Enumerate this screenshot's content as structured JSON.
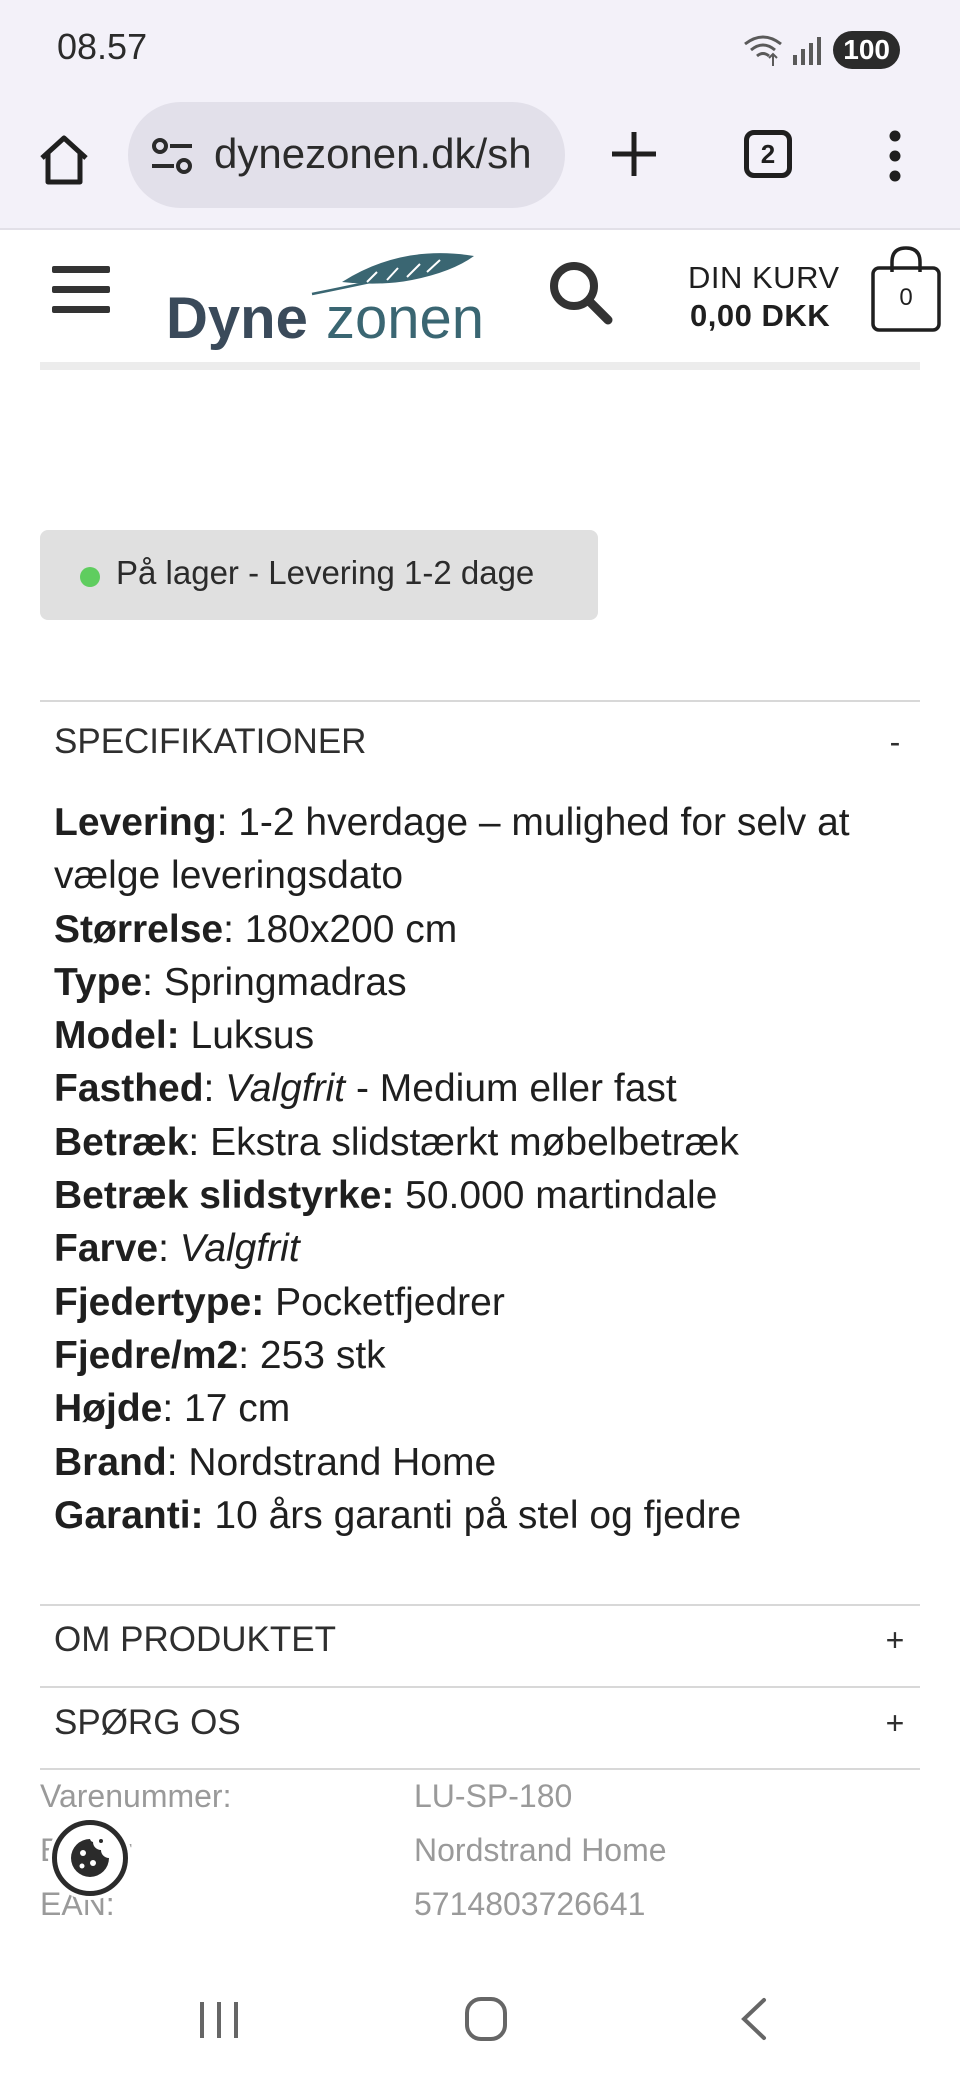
{
  "status_bar": {
    "time": "08.57",
    "battery": "100"
  },
  "browser": {
    "url": "dynezonen.dk/sh",
    "tab_count": "2"
  },
  "header": {
    "logo_text_1": "Dyne",
    "logo_text_2": "zonen",
    "cart_label": "DIN KURV",
    "cart_total": "0,00  DKK",
    "cart_count": "0",
    "colors": {
      "logo_dark": "#3a4a5a",
      "logo_teal": "#3a6672"
    }
  },
  "stock": {
    "text": "På lager - Levering 1-2 dage",
    "dot_color": "#5fcd5f"
  },
  "specs_section": {
    "title": "SPECIFIKATIONER",
    "toggle": "-",
    "rows": [
      {
        "label": "Levering",
        "sep": ": ",
        "value": "1-2 hverdage – mulighed for selv at vælge leveringsdato"
      },
      {
        "label": "Størrelse",
        "sep": ": ",
        "value": "180x200 cm"
      },
      {
        "label": "Type",
        "sep": ": ",
        "value": "Springmadras"
      },
      {
        "label": "Model:",
        "sep": " ",
        "value": "Luksus"
      },
      {
        "label": "Fasthed",
        "sep": ": ",
        "value_italic": "Valgfrit",
        "value": " - Medium eller fast"
      },
      {
        "label": "Betræk",
        "sep": ": ",
        "value": "Ekstra slidstærkt møbelbetræk"
      },
      {
        "label": "Betræk slidstyrke:",
        "sep": " ",
        "value": "50.000 martindale"
      },
      {
        "label": "Farve",
        "sep": ": ",
        "value_italic": "Valgfrit"
      },
      {
        "label": "Fjedertype:",
        "sep": " ",
        "value": "Pocketfjedrer"
      },
      {
        "label": "Fjedre/m2",
        "sep": ": ",
        "value": "253 stk"
      },
      {
        "label": "Højde",
        "sep": ": ",
        "value": "17 cm"
      },
      {
        "label": "Brand",
        "sep": ": ",
        "value": "Nordstrand Home"
      },
      {
        "label": "Garanti:",
        "sep": " ",
        "value": "10 års garanti på stel og fjedre"
      }
    ]
  },
  "accordions": [
    {
      "title": "OM PRODUKTET",
      "toggle": "+"
    },
    {
      "title": "SPØRG OS",
      "toggle": "+"
    }
  ],
  "meta": [
    {
      "label": "Varenummer:",
      "value": "LU-SP-180"
    },
    {
      "label": "Brand:",
      "value": "Nordstrand Home"
    },
    {
      "label": "EAN:",
      "value": "5714803726641"
    }
  ]
}
